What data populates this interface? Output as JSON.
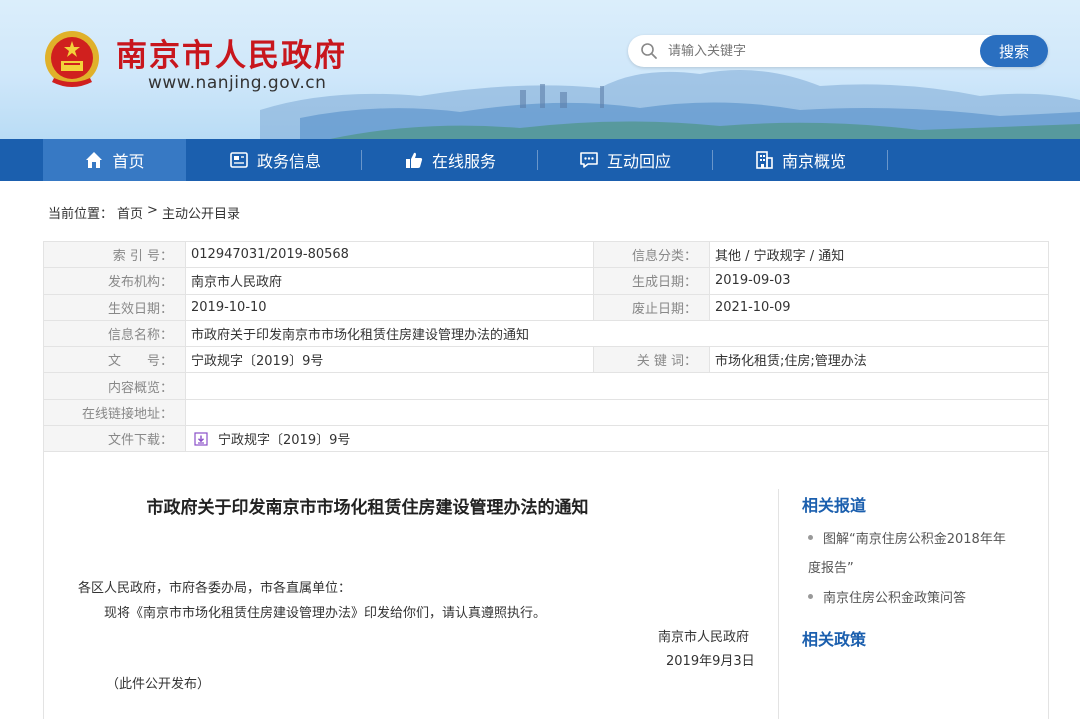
{
  "header": {
    "site_title": "南京市人民政府",
    "site_url": "www.nanjing.gov.cn",
    "search_placeholder": "请输入关键字",
    "search_button": "搜索"
  },
  "nav": {
    "items": [
      {
        "label": "首页",
        "icon": "home-icon"
      },
      {
        "label": "政务信息",
        "icon": "news-icon"
      },
      {
        "label": "在线服务",
        "icon": "thumbs-up-icon"
      },
      {
        "label": "互动回应",
        "icon": "chat-icon"
      },
      {
        "label": "南京概览",
        "icon": "building-icon"
      }
    ]
  },
  "breadcrumb": {
    "prefix": "当前位置：",
    "home": "首页",
    "separator": ">",
    "current": "主动公开目录"
  },
  "info": {
    "index_no_label": "索 引 号：",
    "index_no": "012947031/2019-80568",
    "category_label": "信息分类：",
    "category": "其他 / 宁政规字 / 通知",
    "publisher_label": "发布机构：",
    "publisher": "南京市人民政府",
    "created_label": "生成日期：",
    "created": "2019-09-03",
    "effective_label": "生效日期：",
    "effective": "2019-10-10",
    "expiry_label": "废止日期：",
    "expiry": "2021-10-09",
    "name_label": "信息名称：",
    "name": "市政府关于印发南京市市场化租赁住房建设管理办法的通知",
    "doc_no_label": "文　　号：",
    "doc_no": "宁政规字〔2019〕9号",
    "keywords_label": "关 键 词：",
    "keywords": "市场化租赁;住房;管理办法",
    "summary_label": "内容概览：",
    "summary": "",
    "link_label": "在线链接地址：",
    "link": "",
    "download_label": "文件下载：",
    "download": "宁政规字〔2019〕9号"
  },
  "document": {
    "title": "市政府关于印发南京市市场化租赁住房建设管理办法的通知",
    "addressee": "各区人民政府，市府各委办局，市各直属单位：",
    "body": "现将《南京市市场化租赁住房建设管理办法》印发给你们，请认真遵照执行。",
    "signature": "南京市人民政府",
    "date": "2019年9月3日",
    "note": "（此件公开发布）"
  },
  "sidebar": {
    "related_reports_heading": "相关报道",
    "reports": [
      {
        "line1": "图解“南京住房公积金2018年年",
        "line2": "度报告”"
      },
      {
        "line1": "南京住房公积金政策问答",
        "line2": ""
      }
    ],
    "related_policies_heading": "相关政策"
  },
  "colors": {
    "brand_red": "#c8161d",
    "nav_blue": "#1b5fae",
    "nav_active": "#3779c4",
    "button_blue": "#2a6fc0"
  }
}
